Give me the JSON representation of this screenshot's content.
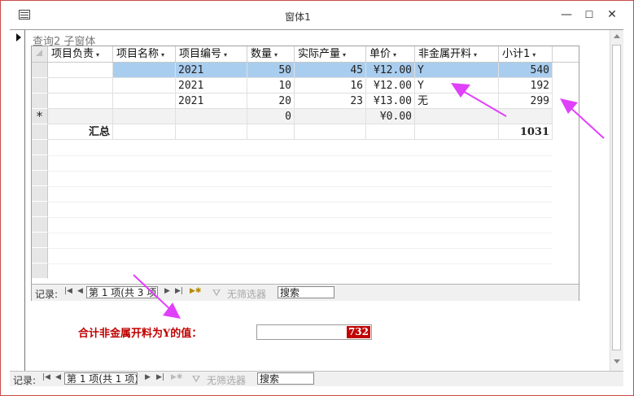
{
  "window": {
    "title": "窗体1"
  },
  "window_controls": {
    "minimize": "—",
    "maximize": "☐",
    "close": "✕"
  },
  "subform": {
    "label": "查询2 子窗体",
    "columns": [
      "项目负责",
      "项目名称",
      "项目编号",
      "数量",
      "实际产量",
      "单价",
      "非金属开料",
      "小计1"
    ],
    "rows": [
      {
        "owner": "",
        "name": "",
        "code": "2021",
        "qty": "50",
        "actual": "45",
        "price": "¥12.00",
        "nonmetal": "Y",
        "subtotal": "540"
      },
      {
        "owner": "",
        "name": "",
        "code": "2021",
        "qty": "10",
        "actual": "16",
        "price": "¥12.00",
        "nonmetal": "Y",
        "subtotal": "192"
      },
      {
        "owner": "",
        "name": "",
        "code": "2021",
        "qty": "20",
        "actual": "23",
        "price": "¥13.00",
        "nonmetal": "无",
        "subtotal": "299"
      }
    ],
    "new_row": {
      "marker": "*",
      "qty": "0",
      "price": "¥0.00"
    },
    "total_row": {
      "label": "汇总",
      "subtotal": "1031"
    },
    "nav": {
      "label": "记录:",
      "position": "第 1 项(共 3 项)",
      "filter": "无筛选器",
      "search": "搜索"
    }
  },
  "summary": {
    "label": "合计非金属开料为Y的值：",
    "value": "732"
  },
  "main_nav": {
    "label": "记录:",
    "position": "第 1 项(共 1 项)",
    "filter": "无筛选器",
    "search": "搜索"
  },
  "colors": {
    "selected_row": "#a9cdee",
    "highlight": "#c00000",
    "arrow": "#e040fb"
  }
}
